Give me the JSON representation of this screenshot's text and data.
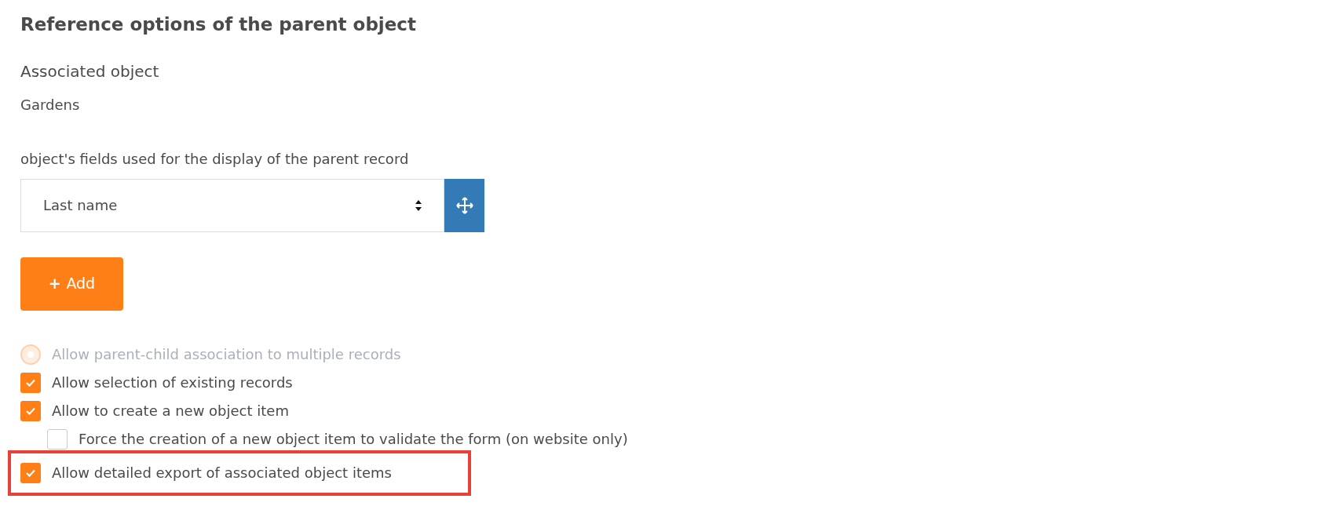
{
  "title": "Reference options of the parent object",
  "associated_object": {
    "heading": "Associated object",
    "value": "Gardens"
  },
  "display_fields": {
    "label": "object's fields used for the display of the parent record",
    "select_value": "Last name"
  },
  "add_button": {
    "icon": "+",
    "label": "Add"
  },
  "options": [
    {
      "kind": "radio",
      "label": "Allow parent-child association to multiple records",
      "checked": true,
      "disabled": true,
      "highlighted": false
    },
    {
      "kind": "checkbox",
      "label": "Allow selection of existing records",
      "checked": true,
      "disabled": false,
      "highlighted": false
    },
    {
      "kind": "checkbox",
      "label": "Allow to create a new object item",
      "checked": true,
      "disabled": false,
      "highlighted": false,
      "children": [
        {
          "kind": "checkbox",
          "label": "Force the creation of a new object item to validate the form (on website only)",
          "checked": false,
          "disabled": false,
          "highlighted": false
        }
      ]
    },
    {
      "kind": "checkbox",
      "label": "Allow detailed export of associated object items",
      "checked": true,
      "disabled": false,
      "highlighted": true
    }
  ]
}
